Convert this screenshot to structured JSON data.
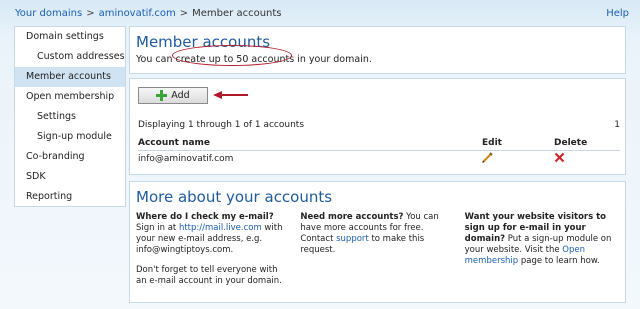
{
  "breadcrumb": {
    "root": "Your domains",
    "sep1": ">",
    "domain": "aminovatif.com",
    "sep2": ">",
    "current": "Member accounts"
  },
  "help_label": "Help",
  "sidebar": {
    "items": [
      {
        "label": "Domain settings"
      },
      {
        "label": "Custom addresses"
      },
      {
        "label": "Member accounts"
      },
      {
        "label": "Open membership"
      },
      {
        "label": "Settings"
      },
      {
        "label": "Sign-up module"
      },
      {
        "label": "Co-branding"
      },
      {
        "label": "SDK"
      },
      {
        "label": "Reporting"
      }
    ]
  },
  "header": {
    "title": "Member accounts",
    "description": "You can create up to 50 accounts in your domain."
  },
  "accounts": {
    "add_label": "Add",
    "displaying": "Displaying 1 through 1 of 1 accounts",
    "page": "1",
    "columns": {
      "name": "Account name",
      "edit": "Edit",
      "delete": "Delete"
    },
    "rows": [
      {
        "name": "info@aminovatif.com"
      }
    ]
  },
  "more": {
    "title": "More about your accounts",
    "col1": {
      "q": "Where do I check my e-mail?",
      "a1": " Sign in at ",
      "link": "http://mail.live.com",
      "a2": " with your new e-mail address, e.g. info@wingtiptoys.com.",
      "p2": "Don't forget to tell everyone with an e-mail account in your domain."
    },
    "col2": {
      "q": "Need more accounts?",
      "a1": " You can have more accounts for free. Contact ",
      "link": "support",
      "a2": " to make this request."
    },
    "col3": {
      "q": "Want your website visitors to sign up for e-mail in your domain?",
      "a1": " Put a sign-up module on your website. Visit the ",
      "link": "Open membership",
      "a2": " page to learn how."
    }
  },
  "colors": {
    "accent": "#1f5a9a",
    "link": "#1a5fb4",
    "annotation": "#b0192a",
    "active_item": "#cfe3f3"
  }
}
